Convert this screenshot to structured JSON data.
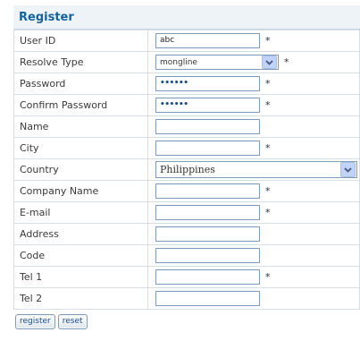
{
  "form": {
    "title": "Register",
    "fields": [
      {
        "label": "User ID",
        "value": "abc",
        "required": "*"
      },
      {
        "label": "Resolve Type",
        "value": "mongline",
        "required": "*"
      },
      {
        "label": "Password",
        "value": "••••••",
        "required": "*"
      },
      {
        "label": "Confirm Password",
        "value": "••••••",
        "required": "*"
      },
      {
        "label": "Name",
        "value": "",
        "required": ""
      },
      {
        "label": "City",
        "value": "",
        "required": "*"
      },
      {
        "label": "Country",
        "value": "Philippines",
        "required": ""
      },
      {
        "label": "Company Name",
        "value": "",
        "required": "*"
      },
      {
        "label": "E-mail",
        "value": "",
        "required": "*"
      },
      {
        "label": "Address",
        "value": "",
        "required": ""
      },
      {
        "label": "Code",
        "value": "",
        "required": ""
      },
      {
        "label": "Tel 1",
        "value": "",
        "required": "*"
      },
      {
        "label": "Tel 2",
        "value": "",
        "required": ""
      }
    ],
    "buttons": {
      "register": "register",
      "reset": "reset"
    }
  },
  "icons": {
    "dropdown": "chevron-down-icon"
  },
  "colors": {
    "title": "#13639e",
    "input_border": "#7f9db9",
    "dropdown_button": "#c1d3fb"
  }
}
